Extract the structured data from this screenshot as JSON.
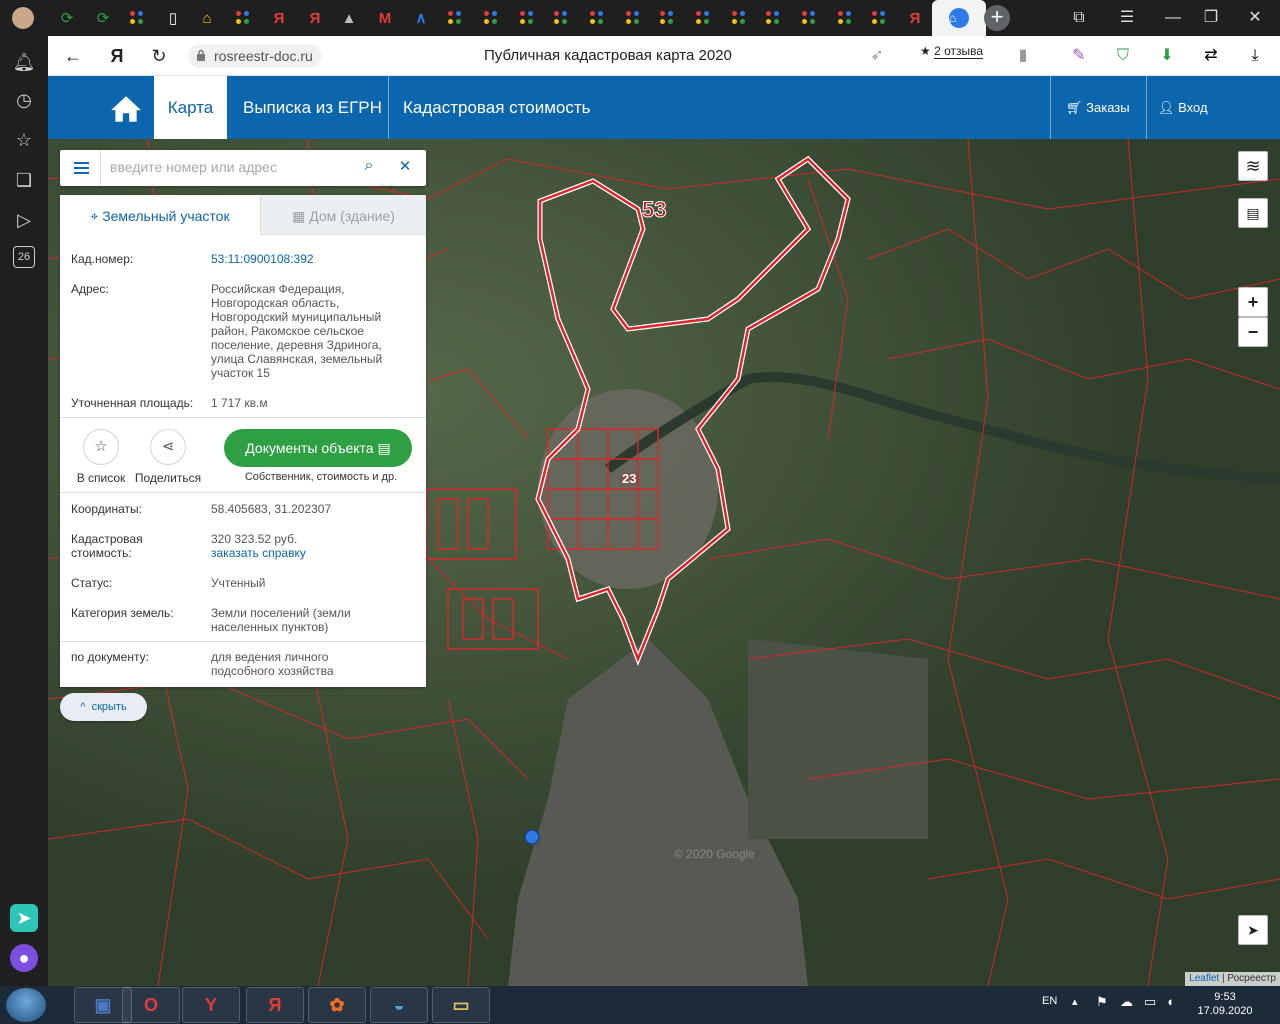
{
  "browser": {
    "url": "rosreestr-doc.ru",
    "page_title": "Публичная кадастровая карта 2020",
    "reviews_label": "2 отзыва",
    "sidebar_badge": "26",
    "sidebar_count": "1"
  },
  "header": {
    "nav_map": "Карта",
    "nav_egrn": "Выписка из ЕГРН",
    "nav_cadastral": "Кадастровая стоимость",
    "orders": "Заказы",
    "login": "Вход"
  },
  "search": {
    "placeholder": "введите номер или адрес"
  },
  "card": {
    "tab_land": "Земельный участок",
    "tab_house": "Дом (здание)",
    "fields": {
      "cad_number_label": "Кад.номер:",
      "cad_number_value": "53:11:0900108:392",
      "address_label": "Адрес:",
      "address_value": "Российская Федерация, Новгородская область, Новгородский муниципальный район, Ракомское сельское поселение, деревня Здринога, улица Славянская, земельный участок 15",
      "area_label": "Уточненная площадь:",
      "area_value": "1 717 кв.м",
      "coords_label": "Координаты:",
      "coords_value": "58.405683, 31.202307",
      "cost_label": "Кадастровая стоимость:",
      "cost_value": "320 323.52 руб.",
      "cost_link": "заказать справку",
      "status_label": "Статус:",
      "status_value": "Учтенный",
      "category_label": "Категория земель:",
      "category_value": "Земли поселений (земли населенных пунктов)",
      "usage_label": "по документу:",
      "usage_value": "для ведения личного подсобного хозяйства"
    },
    "actions": {
      "favorite": "В список",
      "share": "Поделиться",
      "documents": "Документы объекта",
      "documents_sub": "Собственник, стоимость и др."
    },
    "hide": "скрыть"
  },
  "map": {
    "region_label_53": "53",
    "region_label_23": "23",
    "watermark": "© 2020 Google",
    "attribution_leaflet": "Leaflet",
    "attribution_source": "Росреестр",
    "zoom_in": "+",
    "zoom_out": "−"
  },
  "taskbar": {
    "lang": "EN",
    "time": "9:53",
    "date": "17.09.2020"
  },
  "colors": {
    "brand_blue": "#0c66ad",
    "parcel_red": "#e0242b",
    "button_green": "#2ea043"
  }
}
